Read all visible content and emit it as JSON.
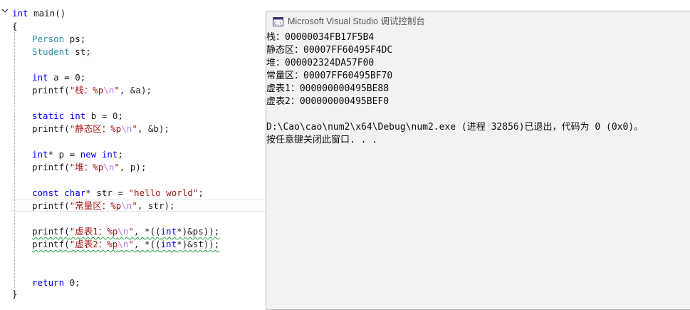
{
  "editor": {
    "lines": {
      "l1_kw": "int",
      "l1_rest": " main()",
      "l2": "{",
      "l3_type": "Person",
      "l3_rest": " ps;",
      "l4_type": "Student",
      "l4_rest": " st;",
      "l5_kw": "int",
      "l5_rest": " a = 0;",
      "l6_fn": "printf(",
      "l6_str": "\"栈：%p",
      "l6_esc": "\\n",
      "l6_str2": "\"",
      "l6_rest": ", &a);",
      "l7_kw1": "static",
      "l7_kw2": "int",
      "l7_rest": " b = 0;",
      "l8_fn": "printf(",
      "l8_str": "\"静态区：%p",
      "l8_esc": "\\n",
      "l8_str2": "\"",
      "l8_rest": ", &b);",
      "l9_kw": "int",
      "l9_rest": "* p = ",
      "l9_kw2": "new",
      "l9_kw3": "int",
      "l9_rest2": ";",
      "l10_fn": "printf(",
      "l10_str": "\"堆：%p",
      "l10_esc": "\\n",
      "l10_str2": "\"",
      "l10_rest": ", p);",
      "l11_kw1": "const",
      "l11_kw2": "char",
      "l11_rest": "* str = ",
      "l11_str": "\"hello world\"",
      "l11_rest2": ";",
      "l12_fn": "printf(",
      "l12_str": "\"常量区：%p",
      "l12_esc": "\\n",
      "l12_str2": "\"",
      "l12_rest": ", str);",
      "l13_fn": "printf(",
      "l13_str": "\"虚表1：%p",
      "l13_esc": "\\n",
      "l13_str2": "\"",
      "l13_rest": ", *((",
      "l13_kw": "int",
      "l13_rest2": "*)&ps));",
      "l14_fn": "printf(",
      "l14_str": "\"虚表2：%p",
      "l14_esc": "\\n",
      "l14_str2": "\"",
      "l14_rest": ", *((",
      "l14_kw": "int",
      "l14_rest2": "*)&st));",
      "l15_kw": "return",
      "l15_rest": " 0;",
      "l16": "}"
    }
  },
  "console": {
    "title": "Microsoft Visual Studio 调试控制台",
    "output": [
      "栈：00000034FB17F5B4",
      "静态区：00007FF60495F4DC",
      "堆：000002324DA57F00",
      "常量区：00007FF60495BF70",
      "虚表1：000000000495BE88",
      "虚表2：000000000495BEF0",
      "",
      "D:\\Cao\\cao\\num2\\x64\\Debug\\num2.exe (进程 32856)已退出，代码为 0 (0x0)。",
      "按任意键关闭此窗口. . ."
    ]
  },
  "colors": {
    "keyword": "#0000ff",
    "type": "#2b91af",
    "string": "#a31515",
    "escape": "#b776fb",
    "squiggle": "#2ea043",
    "console_bg": "#f2f2f2"
  },
  "icons": {
    "collapse": "chevron-down-icon",
    "console_app": "console-app-icon"
  }
}
